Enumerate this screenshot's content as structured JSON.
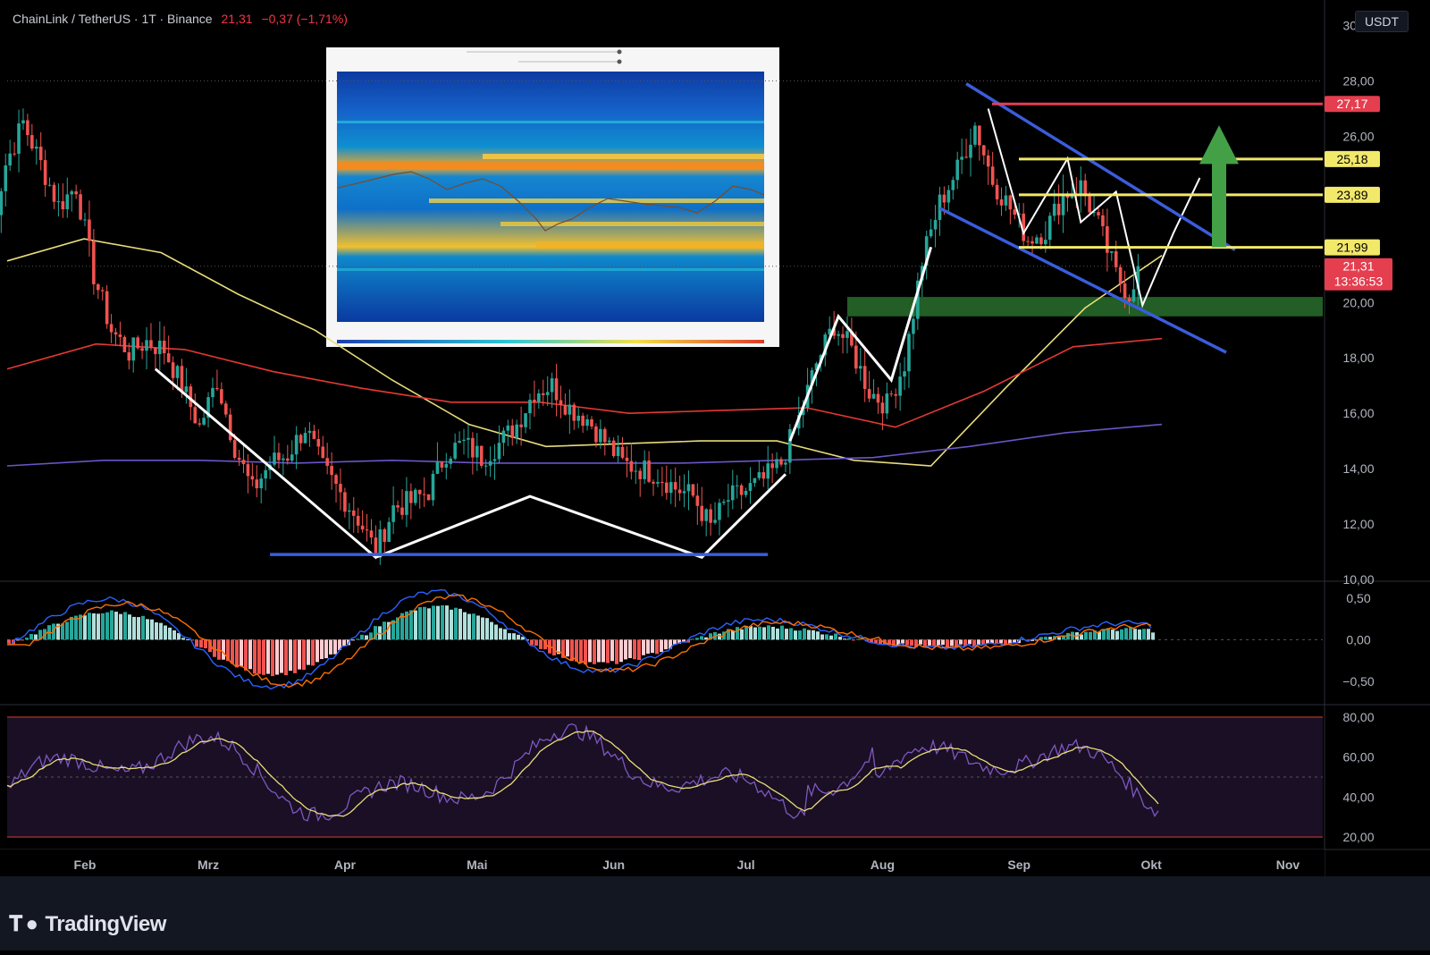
{
  "header": {
    "symbol": "ChainLink / TetherUS · 1T · Binance",
    "last": "21,31",
    "change": "−0,37 (−1,71%)"
  },
  "currency_button": "USDT",
  "footer": {
    "logo_text": "TradingView",
    "logo_icon": "tradingview-logo-icon"
  },
  "colors": {
    "bg": "#000000",
    "up": "#26a69a",
    "down": "#ef5350",
    "ema_yellow": "#e8dc7a",
    "ema_red": "#e53935",
    "ema_purple": "#6a55c8",
    "resistance_red": "#e53e4f",
    "level_yellow": "#f2e86a",
    "channel_blue": "#3a5ddc",
    "zone_green": "#2e7d32",
    "arrow_green": "#43a047"
  },
  "chart_data": [
    {
      "type": "candlestick",
      "name": "price",
      "x_labels": [
        "Feb",
        "Mrz",
        "Apr",
        "Mai",
        "Jun",
        "Jul",
        "Aug",
        "Sep",
        "Okt",
        "Nov"
      ],
      "y_ticks": [
        "30,00",
        "28,00",
        "26,00",
        "24,00",
        "22,00",
        "20,00",
        "18,00",
        "16,00",
        "14,00",
        "12,00",
        "10,00"
      ],
      "ylim": [
        10,
        30.6
      ],
      "series_approx_close": [
        {
          "date": "01-10",
          "v": 22.0
        },
        {
          "date": "01-14",
          "v": 25.0
        },
        {
          "date": "01-18",
          "v": 26.5
        },
        {
          "date": "01-22",
          "v": 25.0
        },
        {
          "date": "01-26",
          "v": 23.5
        },
        {
          "date": "01-30",
          "v": 24.2
        },
        {
          "date": "02-03",
          "v": 21.0
        },
        {
          "date": "02-07",
          "v": 19.0
        },
        {
          "date": "02-11",
          "v": 18.2
        },
        {
          "date": "02-15",
          "v": 18.6
        },
        {
          "date": "02-19",
          "v": 18.3
        },
        {
          "date": "02-23",
          "v": 17.0
        },
        {
          "date": "02-27",
          "v": 15.5
        },
        {
          "date": "03-03",
          "v": 17.2
        },
        {
          "date": "03-07",
          "v": 14.8
        },
        {
          "date": "03-11",
          "v": 13.2
        },
        {
          "date": "03-15",
          "v": 14.2
        },
        {
          "date": "03-19",
          "v": 14.5
        },
        {
          "date": "03-23",
          "v": 15.5
        },
        {
          "date": "03-27",
          "v": 14.0
        },
        {
          "date": "03-31",
          "v": 13.1
        },
        {
          "date": "04-04",
          "v": 12.2
        },
        {
          "date": "04-08",
          "v": 11.0
        },
        {
          "date": "04-12",
          "v": 12.6
        },
        {
          "date": "04-16",
          "v": 12.8
        },
        {
          "date": "04-20",
          "v": 13.2
        },
        {
          "date": "04-24",
          "v": 14.6
        },
        {
          "date": "04-28",
          "v": 14.9
        },
        {
          "date": "05-02",
          "v": 14.4
        },
        {
          "date": "05-06",
          "v": 14.9
        },
        {
          "date": "05-10",
          "v": 15.6
        },
        {
          "date": "05-14",
          "v": 16.8
        },
        {
          "date": "05-18",
          "v": 17.0
        },
        {
          "date": "05-22",
          "v": 16.2
        },
        {
          "date": "05-26",
          "v": 15.8
        },
        {
          "date": "05-30",
          "v": 15.0
        },
        {
          "date": "06-03",
          "v": 14.2
        },
        {
          "date": "06-07",
          "v": 14.0
        },
        {
          "date": "06-11",
          "v": 13.8
        },
        {
          "date": "06-15",
          "v": 13.3
        },
        {
          "date": "06-19",
          "v": 13.0
        },
        {
          "date": "06-23",
          "v": 11.9
        },
        {
          "date": "06-27",
          "v": 12.9
        },
        {
          "date": "07-01",
          "v": 13.2
        },
        {
          "date": "07-05",
          "v": 13.6
        },
        {
          "date": "07-09",
          "v": 14.2
        },
        {
          "date": "07-13",
          "v": 15.8
        },
        {
          "date": "07-17",
          "v": 17.8
        },
        {
          "date": "07-21",
          "v": 19.2
        },
        {
          "date": "07-25",
          "v": 18.3
        },
        {
          "date": "07-29",
          "v": 16.8
        },
        {
          "date": "08-02",
          "v": 16.3
        },
        {
          "date": "08-06",
          "v": 17.8
        },
        {
          "date": "08-10",
          "v": 21.5
        },
        {
          "date": "08-14",
          "v": 23.6
        },
        {
          "date": "08-18",
          "v": 24.8
        },
        {
          "date": "08-22",
          "v": 26.4
        },
        {
          "date": "08-26",
          "v": 24.4
        },
        {
          "date": "08-30",
          "v": 23.4
        },
        {
          "date": "09-03",
          "v": 22.3
        },
        {
          "date": "09-07",
          "v": 22.6
        },
        {
          "date": "09-11",
          "v": 23.9
        },
        {
          "date": "09-15",
          "v": 24.2
        },
        {
          "date": "09-19",
          "v": 22.8
        },
        {
          "date": "09-23",
          "v": 21.0
        },
        {
          "date": "09-26",
          "v": 20.3
        },
        {
          "date": "09-28",
          "v": 21.31
        }
      ],
      "moving_averages": [
        {
          "color": "yellow",
          "values_approx": [
            21.5,
            22.3,
            21.8,
            20.3,
            19.0,
            17.2,
            15.6,
            14.8,
            14.9,
            15.0,
            15.0,
            14.3,
            14.1,
            17.0,
            19.8,
            21.7
          ]
        },
        {
          "color": "red",
          "values_approx": [
            17.6,
            18.5,
            18.3,
            17.5,
            16.9,
            16.4,
            16.4,
            16.0,
            16.1,
            16.2,
            15.5,
            16.8,
            18.4,
            18.7
          ]
        },
        {
          "color": "purple",
          "values_approx": [
            14.1,
            14.3,
            14.3,
            14.2,
            14.3,
            14.2,
            14.2,
            14.2,
            14.3,
            14.4,
            14.8,
            15.3,
            15.6
          ]
        }
      ],
      "horizontal_levels": [
        {
          "price": 27.17,
          "label": "27,17",
          "color": "red"
        },
        {
          "price": 25.18,
          "label": "25,18",
          "color": "yellow"
        },
        {
          "price": 23.89,
          "label": "23,89",
          "color": "yellow"
        },
        {
          "price": 21.99,
          "label": "21,99",
          "color": "yellow"
        }
      ],
      "price_tag": {
        "price": 21.31,
        "label": "21,31",
        "countdown": "13:36:53"
      },
      "zone": {
        "from": 19.5,
        "to": 20.2,
        "color": "green"
      },
      "support_line": {
        "price": 10.9
      },
      "channel": {
        "upper": [
          [
            "08-20",
            27.9
          ],
          [
            "10-20",
            21.9
          ]
        ],
        "lower": [
          [
            "08-14",
            23.4
          ],
          [
            "10-18",
            18.2
          ]
        ]
      }
    },
    {
      "type": "histogram",
      "name": "MACD",
      "y_ticks": [
        "0,50",
        "0,00",
        "−0,50"
      ],
      "ylim": [
        -0.75,
        0.65
      ]
    },
    {
      "type": "line",
      "name": "RSI",
      "y_ticks": [
        "80,00",
        "60,00",
        "40,00",
        "20,00"
      ],
      "ylim": [
        16,
        84
      ],
      "bands": [
        80,
        20
      ],
      "midline": 50
    }
  ]
}
